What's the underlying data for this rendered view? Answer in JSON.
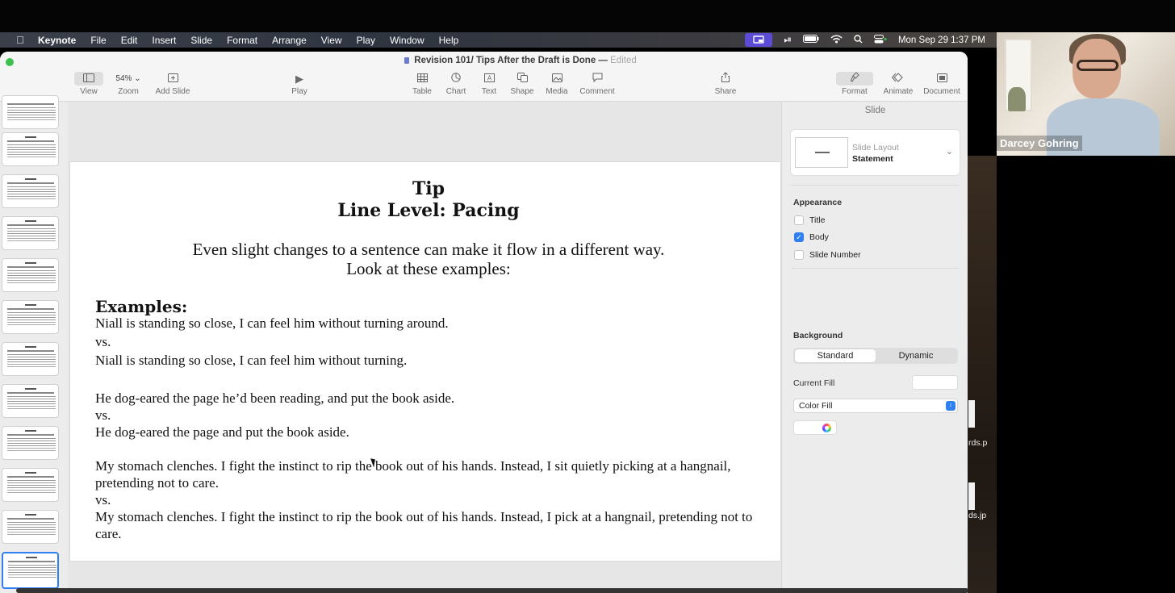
{
  "menubar": {
    "app": "Keynote",
    "items": [
      "File",
      "Edit",
      "Insert",
      "Slide",
      "Format",
      "Arrange",
      "View",
      "Play",
      "Window",
      "Help"
    ],
    "clock": "Mon Sep 29  1:37 PM"
  },
  "window": {
    "title": "Revision 101/ Tips After the Draft is Done",
    "separator": "—",
    "status": "Edited"
  },
  "toolbar": {
    "view": "View",
    "zoom_value": "54%",
    "zoom": "Zoom",
    "add_slide": "Add Slide",
    "play": "Play",
    "table": "Table",
    "chart": "Chart",
    "text": "Text",
    "shape": "Shape",
    "media": "Media",
    "comment": "Comment",
    "share": "Share",
    "format": "Format",
    "animate": "Animate",
    "document": "Document"
  },
  "slide": {
    "title_line1": "Tip",
    "title_line2": "Line Level: Pacing",
    "intro_line1": "Even slight changes to a sentence can make it flow in a different way.",
    "intro_line2": "Look at these examples:",
    "examples_heading": "Examples:",
    "lines": [
      "Niall is standing so close, I can feel him without turning around.",
      "vs.",
      "Niall is standing so close, I can feel him without turning.",
      "He dog-eared the page he’d been reading, and put the book aside.",
      "vs.",
      "He dog-eared the page and put the book aside.",
      "My stomach clenches. I fight the instinct to rip the book out of his hands. Instead, I sit quietly picking at a hangnail, pretending not to care.",
      "vs.",
      "My stomach clenches. I fight the instinct to rip the book out of his hands. Instead, I pick at a hangnail, pretending not to care."
    ]
  },
  "inspector": {
    "tab": "Slide",
    "layout_label": "Slide Layout",
    "layout_value": "Statement",
    "appearance": "Appearance",
    "opt_title": "Title",
    "opt_body": "Body",
    "opt_slide_number": "Slide Number",
    "background": "Background",
    "seg_standard": "Standard",
    "seg_dynamic": "Dynamic",
    "current_fill": "Current Fill",
    "fill_type": "Color Fill"
  },
  "desktop": {
    "file1": "rds.p",
    "file2": "ds.jp"
  },
  "video": {
    "participant": "Darcey Gohring"
  },
  "colors": {
    "accent": "#2f7ff0",
    "cast_button": "#5b4bd6",
    "traffic_green": "#3cc150"
  }
}
